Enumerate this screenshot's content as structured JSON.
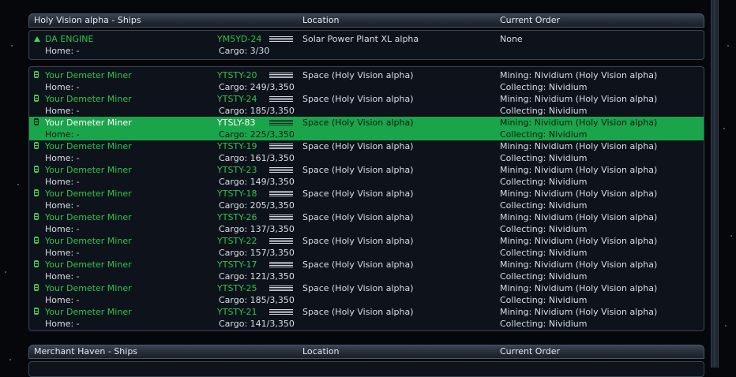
{
  "colors": {
    "accent_green": "#2fc24e",
    "selected_row": "#1ba54b",
    "background": "#05070b"
  },
  "section1": {
    "title": "Holy Vision alpha - Ships",
    "col_location": "Location",
    "col_order": "Current Order"
  },
  "top_ship": {
    "name": "DA ENGINE",
    "home": "Home: -",
    "code": "YM5YD-24",
    "cargo": "Cargo: 3/30",
    "location": "Solar Power Plant XL alpha",
    "order": "None",
    "icon": "triangle-up-icon"
  },
  "ships": [
    {
      "name": "Your Demeter Miner",
      "home": "Home: -",
      "code": "YTSTY-20",
      "cargo": "Cargo: 249/3,350",
      "location": "Space (Holy Vision alpha)",
      "order": "Mining: Nividium (Holy Vision alpha)",
      "order2": "Collecting: Nividium",
      "selected": false
    },
    {
      "name": "Your Demeter Miner",
      "home": "Home: -",
      "code": "YTSTY-24",
      "cargo": "Cargo: 185/3,350",
      "location": "Space (Holy Vision alpha)",
      "order": "Mining: Nividium (Holy Vision alpha)",
      "order2": "Collecting: Nividium",
      "selected": false
    },
    {
      "name": "Your Demeter Miner",
      "home": "Home: -",
      "code": "YTSLY-83",
      "cargo": "Cargo: 225/3,350",
      "location": "Space (Holy Vision alpha)",
      "order": "Mining: Nividium (Holy Vision alpha)",
      "order2": "Collecting: Nividium",
      "selected": true
    },
    {
      "name": "Your Demeter Miner",
      "home": "Home: -",
      "code": "YTSTY-19",
      "cargo": "Cargo: 161/3,350",
      "location": "Space (Holy Vision alpha)",
      "order": "Mining: Nividium (Holy Vision alpha)",
      "order2": "Collecting: Nividium",
      "selected": false
    },
    {
      "name": "Your Demeter Miner",
      "home": "Home: -",
      "code": "YTSTY-23",
      "cargo": "Cargo: 149/3,350",
      "location": "Space (Holy Vision alpha)",
      "order": "Mining: Nividium (Holy Vision alpha)",
      "order2": "Collecting: Nividium",
      "selected": false
    },
    {
      "name": "Your Demeter Miner",
      "home": "Home: -",
      "code": "YTSTY-18",
      "cargo": "Cargo: 205/3,350",
      "location": "Space (Holy Vision alpha)",
      "order": "Mining: Nividium (Holy Vision alpha)",
      "order2": "Collecting: Nividium",
      "selected": false
    },
    {
      "name": "Your Demeter Miner",
      "home": "Home: -",
      "code": "YTSTY-26",
      "cargo": "Cargo: 137/3,350",
      "location": "Space (Holy Vision alpha)",
      "order": "Mining: Nividium (Holy Vision alpha)",
      "order2": "Collecting: Nividium",
      "selected": false
    },
    {
      "name": "Your Demeter Miner",
      "home": "Home: -",
      "code": "YTSTY-22",
      "cargo": "Cargo: 157/3,350",
      "location": "Space (Holy Vision alpha)",
      "order": "Mining: Nividium (Holy Vision alpha)",
      "order2": "Collecting: Nividium",
      "selected": false
    },
    {
      "name": "Your Demeter Miner",
      "home": "Home: -",
      "code": "YTSTY-17",
      "cargo": "Cargo: 121/3,350",
      "location": "Space (Holy Vision alpha)",
      "order": "Mining: Nividium (Holy Vision alpha)",
      "order2": "Collecting: Nividium",
      "selected": false
    },
    {
      "name": "Your Demeter Miner",
      "home": "Home: -",
      "code": "YTSTY-25",
      "cargo": "Cargo: 185/3,350",
      "location": "Space (Holy Vision alpha)",
      "order": "Mining: Nividium (Holy Vision alpha)",
      "order2": "Collecting: Nividium",
      "selected": false
    },
    {
      "name": "Your Demeter Miner",
      "home": "Home: -",
      "code": "YTSTY-21",
      "cargo": "Cargo: 141/3,350",
      "location": "Space (Holy Vision alpha)",
      "order": "Mining: Nividium (Holy Vision alpha)",
      "order2": "Collecting: Nividium",
      "selected": false
    }
  ],
  "section2": {
    "title": "Merchant Haven - Ships",
    "col_location": "Location",
    "col_order": "Current Order"
  }
}
